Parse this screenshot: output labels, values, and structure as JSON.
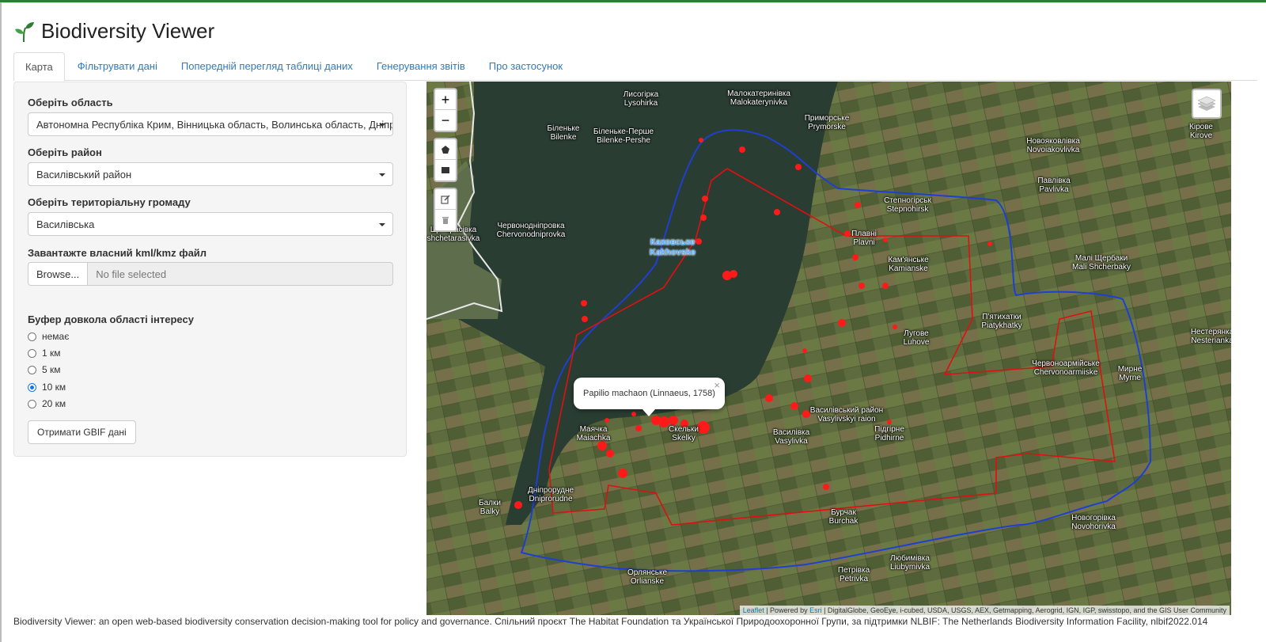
{
  "app": {
    "title": "Biodiversity Viewer",
    "logo_icon": "sprout-icon"
  },
  "tabs": [
    {
      "label": "Карта",
      "active": true
    },
    {
      "label": "Фільтрувати дані",
      "active": false
    },
    {
      "label": "Попередній перегляд таблиці даних",
      "active": false
    },
    {
      "label": "Генерування звітів",
      "active": false
    },
    {
      "label": "Про застосунок",
      "active": false
    }
  ],
  "sidebar": {
    "region_label": "Оберіть область",
    "region_value": "Автономна Республіка Крим, Вінницька область, Волинська область, Дніпропетровська область",
    "district_label": "Оберіть район",
    "district_value": "Василівський район",
    "community_label": "Оберіть територіальну громаду",
    "community_value": "Василівська",
    "upload_label": "Завантажте власний kml/kmz файл",
    "browse_label": "Browse...",
    "file_placeholder": "No file selected",
    "buffer_label": "Буфер довкола області інтересу",
    "buffer_options": [
      "немає",
      "1 км",
      "5 км",
      "10 км",
      "20 км"
    ],
    "buffer_selected": "10 км",
    "gbif_button": "Отримати GBIF дані"
  },
  "map": {
    "zoom_in": "+",
    "zoom_out": "−",
    "popup_text": "Papilio machaon (Linnaeus, 1758)",
    "popup_close": "×",
    "water_label": [
      "Каховське",
      "Kakhovske"
    ],
    "places": [
      [
        "Лисогірка",
        "Lysohirka"
      ],
      [
        "Малокатеринівка",
        "Malokaterynivka"
      ],
      [
        "Біленьке",
        "Bilenke"
      ],
      [
        "Біленьке-Перше",
        "Bilenke-Pershe"
      ],
      [
        "Приморське",
        "Prymorske"
      ],
      [
        "Новояковлівка",
        "Novoiakovlivka"
      ],
      [
        "Павлівка",
        "Pavlivka"
      ],
      [
        "Степногірськ",
        "Stepnohirsk"
      ],
      [
        "Червонодніпровка",
        "Chervonodniprovka"
      ],
      [
        "Плавні",
        "Plavni"
      ],
      [
        "Кам'янське",
        "Kamianske"
      ],
      [
        "Малі Щербаки",
        "Mali Shcherbaky"
      ],
      [
        "П'ятихатки",
        "Piatykhatky"
      ],
      [
        "Лугове",
        "Luhove"
      ],
      [
        "Червоноармійське",
        "Chervonoarmiiske"
      ],
      [
        "Мирне",
        "Myrne"
      ],
      [
        "Маячка",
        "Maiachka"
      ],
      [
        "Скельки",
        "Skelky"
      ],
      [
        "Василівка",
        "Vasylivka"
      ],
      [
        "Василівський район",
        "Vasylivskyi raion"
      ],
      [
        "Підгірне",
        "Pidhirne"
      ],
      [
        "Дніпрорудне",
        "Dniprorudne"
      ],
      [
        "Балки",
        "Balky"
      ],
      [
        "Бурчак",
        "Burchak"
      ],
      [
        "Новогорівка",
        "Novohorivka"
      ],
      [
        "Орлянське",
        "Orlianske"
      ],
      [
        "Петрівка",
        "Petrivka"
      ],
      [
        "Любимівка",
        "Liubymivka"
      ],
      [
        "Кірове",
        "Kirove"
      ],
      [
        "Нестерянка",
        "Nesterianka"
      ],
      [
        "Щетарасівка",
        "shchetarasivka"
      ]
    ],
    "attribution_leaflet": "Leaflet",
    "attribution_mid": " | Powered by ",
    "attribution_esri": "Esri",
    "attribution_rest": " | DigitalGlobe, GeoEye, i-cubed, USDA, USGS, AEX, Getmapping, Aerogrid, IGN, IGP, swisstopo, and the GIS User Community",
    "colors": {
      "buffer": "#1f3fd1",
      "district": "#e01010",
      "occurrence": "#ff1a1a",
      "water": "#2a3d33"
    }
  },
  "footer": "Biodiversity Viewer: an open web-based biodiversity conservation decision-making tool for policy and governance. Спільний проєкт The Habitat Foundation та Української Природоохоронної Групи, за підтримки NLBIF: The Netherlands Biodiversity Information Facility, nlbif2022.014"
}
